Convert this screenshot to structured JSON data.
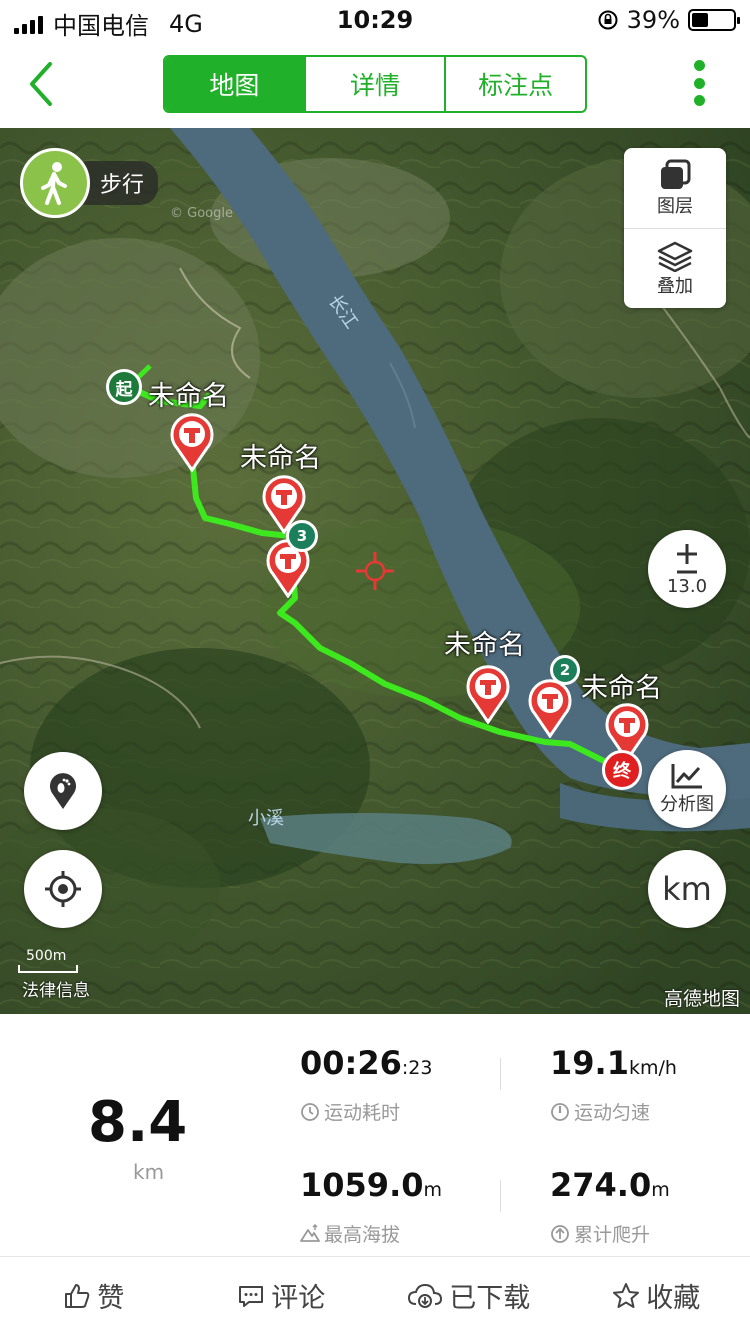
{
  "status_bar": {
    "carrier": "中国电信",
    "network": "4G",
    "time": "10:29",
    "battery": "39%",
    "battery_level": 0.39
  },
  "nav": {
    "back_icon": "chevron-left-icon",
    "tabs": [
      {
        "label": "地图",
        "active": true
      },
      {
        "label": "详情",
        "active": false
      },
      {
        "label": "标注点",
        "active": false
      }
    ],
    "more_icon": "more-vertical-icon",
    "accent_color": "#21b02a"
  },
  "map": {
    "activity_label": "步行",
    "layers_label": "图层",
    "overlay_label": "叠加",
    "zoom_level": "13.0",
    "analysis_label": "分析图",
    "unit_toggle_label": "km",
    "start_label": "起",
    "end_label": "终",
    "waypoint_labels": [
      "未命名",
      "未命名",
      "未命名",
      "未命名"
    ],
    "km_markers": [
      "3",
      "2"
    ],
    "river_labels": [
      "长江",
      "小溪"
    ],
    "scale_label": "500m",
    "legal_label": "法律信息",
    "provider_label": "高德地图",
    "watermark": "© Google"
  },
  "stats": {
    "distance": "8.4",
    "distance_unit": "km",
    "duration_main": "00:26",
    "duration_seconds": ":23",
    "duration_label": "运动耗时",
    "speed": "19.1",
    "speed_unit": "km/h",
    "speed_label": "运动匀速",
    "max_altitude": "1059.0",
    "max_altitude_unit": "m",
    "max_altitude_label": "最高海拔",
    "total_climb": "274.0",
    "total_climb_unit": "m",
    "total_climb_label": "累计爬升"
  },
  "actions": {
    "like": "赞",
    "comment": "评论",
    "downloaded": "已下载",
    "favorite": "收藏"
  }
}
